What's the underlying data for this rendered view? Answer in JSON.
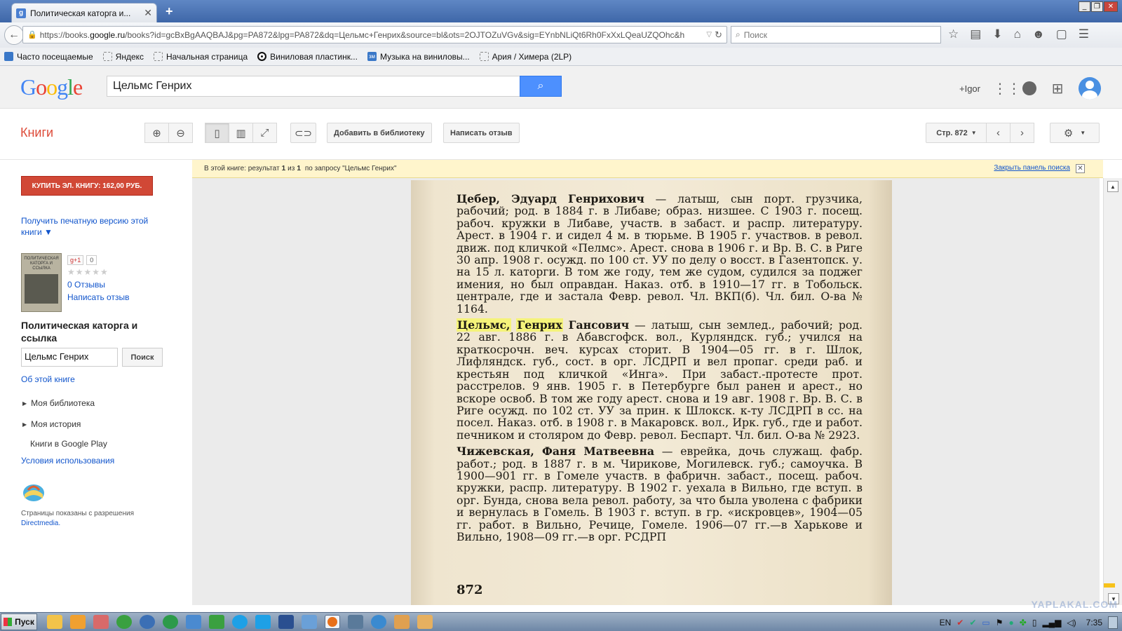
{
  "browser": {
    "tab_title": "Политическая каторга и...",
    "url_prefix": "https://books.",
    "url_domain": "google.ru",
    "url_rest": "/books?id=gcBxBgAAQBAJ&pg=PA872&lpg=PA872&dq=Цельмс+Генрих&source=bl&ots=2OJTOZuVGv&sig=EYnbNLiQt6Rh0FxXxLQeaUZQOhc&h",
    "search_placeholder": "Поиск",
    "bookmarks": [
      {
        "label": "Часто посещаемые",
        "icon": "firefox-bookmark-icon"
      },
      {
        "label": "Яндекс",
        "icon": "page-icon"
      },
      {
        "label": "Начальная страница",
        "icon": "page-icon"
      },
      {
        "label": "Виниловая пластинк...",
        "icon": "vinyl-icon"
      },
      {
        "label": "Музыка на виниловы...",
        "icon": "zm-icon"
      },
      {
        "label": "Ария / Химера (2LP)",
        "icon": "page-icon"
      }
    ]
  },
  "google": {
    "logo": "Google",
    "query": "Цельмс Генрих",
    "user": "+Igor"
  },
  "toolbar": {
    "section_title": "Книги",
    "add_to_library": "Добавить в библиотеку",
    "write_review": "Написать отзыв",
    "page_select": "Стр. 872"
  },
  "sidebar": {
    "buy_button": "КУПИТЬ ЭЛ. КНИГУ: 162,00 РУБ.",
    "print_version": "Получить печатную версию этой книги ▼",
    "cover_text": "ПОЛИТИЧЕСКАЯ КАТОРГА И ССЫЛКА",
    "gplus_label": "g+1",
    "gplus_count": "0",
    "reviews_count": "0 Отзывы",
    "write_review": "Написать отзыв",
    "book_title": "Политическая каторга и ссылка",
    "search_value": "Цельмс Генрих",
    "search_button": "Поиск",
    "about_book": "Об этой книге",
    "my_library": "Моя библиотека",
    "my_history": "Моя история",
    "google_play": "Книги в Google Play",
    "terms": "Условия использования",
    "permission_text": "Страницы показаны с разрешения",
    "publisher": "Directmedia."
  },
  "infobar": {
    "prefix": "В этой книге: результат",
    "n": "1",
    "of": "из",
    "total": "1",
    "query_text": "по запросу \"Цельмс Генрих\"",
    "close_panel": "Закрыть панель поиска"
  },
  "page": {
    "entries": [
      {
        "name": "Цебер, Эдуард Генрихович",
        "text": " — латыш, сын порт. грузчика, рабочий; род. в 1884 г. в Либаве; образ. низшее. С 1903 г. посещ. рабоч. кружки в Либаве, участв. в забаст. и распр. литературу. Арест. в 1904 г. и сидел 4 м. в тюрьме. В 1905 г. участвов. в револ. движ. под кличкой «Пелмс». Арест. снова в 1906 г. и Вр. В. С. в Риге 30 апр. 1908 г. осужд. по 100 ст. УУ по делу о восст. в Газентопск. у. на 15 л. каторги. В том же году, тем же судом, судился за поджег имения, но был оправдан. Наказ. отб. в 1910—17 гг. в Тобольск. централе, где и застала Февр. револ. Чл. ВКП(б). Чл. бил. О-ва № 1164."
      },
      {
        "hl1": "Цельмс,",
        "hl2": "Генрих",
        "name": "Гансович",
        "text": " — латыш, сын землед., рабочий; род. 22 авг. 1886 г. в Абавсгофск. вол., Курляндск. губ.; учился на краткосрочн. веч. курсах сторит. В 1904—05 гг. в г. Шлок, Лифляндск. губ., сост. в орг. ЛСДРП и вел пропаг. среди раб. и крестьян под кличкой «Инга». При забаст.-протесте прот. расстрелов. 9 янв. 1905 г. в Петербурге был ранен и арест., но вскоре освоб. В том же году арест. снова и 19 авг. 1908 г. Вр. В. С. в Риге осужд. по 102 ст. УУ за прин. к Шлокск. к-ту ЛСДРП в сс. на посел. Наказ. отб. в 1908 г. в Макаровск. вол., Ирк. губ., где и работ. печником и столяром до Февр. револ. Беспарт. Чл. бил. О-ва № 2923."
      },
      {
        "name": "Чижевская, Фаня Матвеевна",
        "text": " — еврейка, дочь служащ. фабр. работ.; род. в 1887 г. в м. Чирикове, Могилевск. губ.; самоучка. В 1900—901 гг. в Гомеле участв. в фабричн. забаст., посещ. рабоч. кружки, распр. литературу. В 1902 г. уехала в Вильно, где вступ. в орг. Бунда, снова вела револ. работу, за что была уволена с фабрики и вернулась в Гомель. В 1903 г. вступ. в гр. «искровцев», 1904—05 гг. работ. в Вильно, Речице, Гомеле. 1906—07 гг.—в Харькове и Вильно, 1908—09 гг.—в орг. РСДРП"
      }
    ],
    "page_number": "872"
  },
  "taskbar": {
    "start": "Пуск",
    "lang": "EN",
    "time": "7:35",
    "watermark": "YAPLAKAL.COM"
  }
}
